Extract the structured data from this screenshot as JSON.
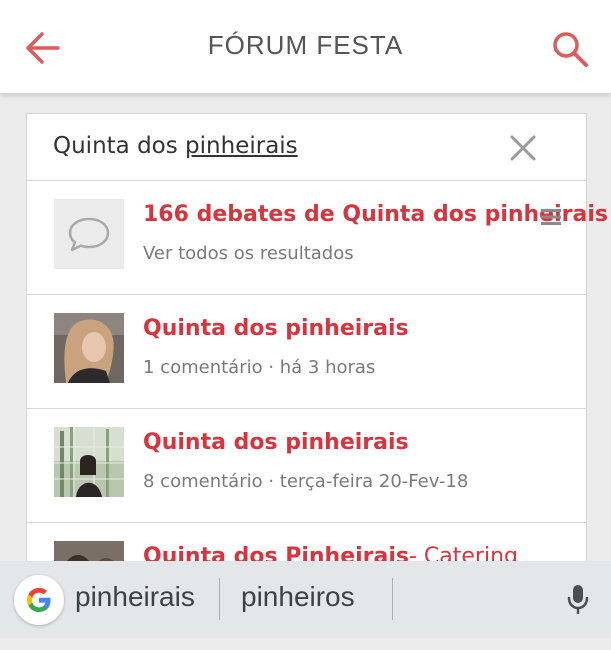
{
  "appbar": {
    "title": "FÓRUM FESTA",
    "back_icon": "arrow-left-icon",
    "search_icon": "search-icon",
    "accent_color": "#e05a5a"
  },
  "search": {
    "query_prefix": "Quinta dos ",
    "query_underlined": "pinheirais",
    "clear_icon": "close-icon"
  },
  "results": [
    {
      "title": "166 debates de Quinta dos pinheirais",
      "subtitle": "Ver todos os resultados",
      "icon": "comment-bubble-icon",
      "menu_icon": "hamburger-menu-icon"
    },
    {
      "title": "Quinta dos pinheirais",
      "subtitle": "1 comentário · há 3 horas",
      "avatar": "user-avatar"
    },
    {
      "title": "Quinta dos pinheirais",
      "subtitle": "8 comentário · terça-feira 20-Fev-18",
      "avatar": "user-avatar"
    },
    {
      "title": "Quinta dos Pinheirais",
      "title_suffix": "- Catering",
      "avatar": "user-avatar"
    }
  ],
  "keyboard_suggestions": {
    "google_icon": "google-g-icon",
    "items": [
      "pinheirais",
      "pinheiros"
    ],
    "mic_icon": "microphone-icon"
  },
  "colors": {
    "title_red": "#d9343e",
    "muted_text": "#7a7a7a"
  }
}
